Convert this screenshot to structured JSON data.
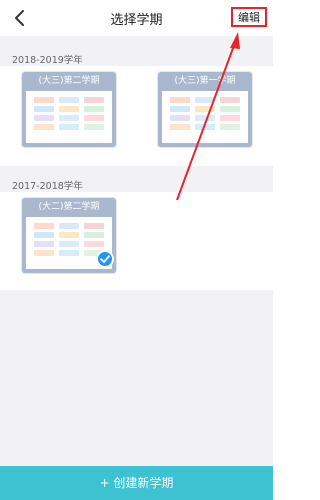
{
  "header": {
    "title": "选择学期",
    "edit_label": "编辑",
    "back_icon": "back-chevron-icon"
  },
  "sections": [
    {
      "year": "2018-2019学年",
      "terms": [
        {
          "label": "(大三)第二学期",
          "selected": false
        },
        {
          "label": "(大三)第一学期",
          "selected": false
        }
      ]
    },
    {
      "year": "2017-2018学年",
      "terms": [
        {
          "label": "(大二)第二学期",
          "selected": true
        }
      ]
    }
  ],
  "footer": {
    "create_label": "+ 创建新学期"
  },
  "colors": {
    "accent": "#3cc2d1",
    "card_header": "#a9b8cf",
    "check": "#2196f3",
    "annotation": "#e8242a"
  }
}
